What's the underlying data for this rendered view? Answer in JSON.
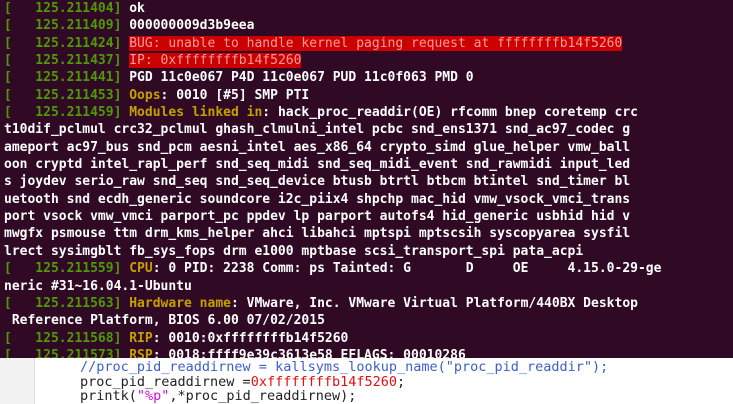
{
  "terminal": {
    "lines": [
      {
        "ts": "[   125.211404]",
        "text": "ok"
      },
      {
        "ts": "[   125.211409]",
        "text": "000000009d3b9eea"
      },
      {
        "ts": "[   125.211424]",
        "label": "BUG",
        "hl": ": unable to handle kernel paging request at ffffffffb14f5260"
      },
      {
        "ts": "[   125.211437]",
        "label": "IP",
        "hl": ": 0xffffffffb14f5260"
      },
      {
        "ts": "[   125.211441]",
        "text": "PGD 11c0e067 P4D 11c0e067 PUD 11c0f063 PMD 0"
      },
      {
        "ts": "[   125.211453]",
        "label": "Oops",
        "text": ": 0010 [#5] SMP PTI"
      },
      {
        "ts": "[   125.211459]",
        "label": "Modules linked in",
        "text": ": hack_proc_readdir(OE) rfcomm bnep coretemp crc"
      },
      {
        "text": "t10dif_pclmul crc32_pclmul ghash_clmulni_intel pcbc snd_ens1371 snd_ac97_codec g"
      },
      {
        "text": "ameport ac97_bus snd_pcm aesni_intel aes_x86_64 crypto_simd glue_helper vmw_ball"
      },
      {
        "text": "oon cryptd intel_rapl_perf snd_seq_midi snd_seq_midi_event snd_rawmidi input_led"
      },
      {
        "text": "s joydev serio_raw snd_seq snd_seq_device btusb btrtl btbcm btintel snd_timer bl"
      },
      {
        "text": "uetooth snd ecdh_generic soundcore i2c_piix4 shpchp mac_hid vmw_vsock_vmci_trans"
      },
      {
        "text": "port vsock vmw_vmci parport_pc ppdev lp parport autofs4 hid_generic usbhid hid v"
      },
      {
        "text": "mwgfx psmouse ttm drm_kms_helper ahci libahci mptspi mptscsih syscopyarea sysfil"
      },
      {
        "text": "lrect sysimgblt fb_sys_fops drm e1000 mptbase scsi_transport_spi pata_acpi"
      },
      {
        "ts": "[   125.211559]",
        "label": "CPU",
        "text": ": 0 PID: 2238 Comm: ps Tainted: G       D     OE     4.15.0-29-ge"
      },
      {
        "text": "neric #31~16.04.1-Ubuntu"
      },
      {
        "ts": "[   125.211563]",
        "label": "Hardware name",
        "text": ": VMware, Inc. VMware Virtual Platform/440BX Desktop"
      },
      {
        "text": " Reference Platform, BIOS 6.00 07/02/2015"
      },
      {
        "ts": "[   125.211568]",
        "label": "RIP",
        "text": ": 0010:0xffffffffb14f5260"
      },
      {
        "ts": "[   125.211573]",
        "label": "RSP",
        "text": ": 0018:ffff9e39c3613e58 EFLAGS: 00010286"
      }
    ]
  },
  "editor": {
    "line1": "//proc_pid_readdirnew = kallsyms_lookup_name(\"proc_pid_readdir\");",
    "line2_code": "proc_pid_readdirnew =",
    "line2_num": "0xffffffffb14f5260",
    "line2_end": ";",
    "line3_code": "printk(",
    "line3_str": "\"%p\"",
    "line3_end": ",*proc_pid_readdirnew);"
  },
  "colors": {
    "terminal_bg": "#300a24",
    "timestamp_green": "#4e9a06",
    "label_yellow": "#c4a000",
    "highlight_red": "#cc0000"
  }
}
